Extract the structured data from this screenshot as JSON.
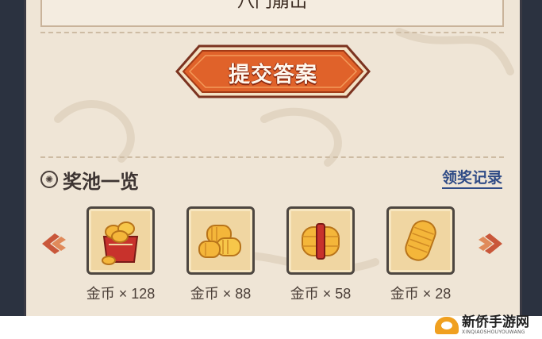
{
  "answer": {
    "text": "八门崩出"
  },
  "submit_button": {
    "label": "提交答案"
  },
  "prize_pool": {
    "title": "奖池一览",
    "records_link": "领奖记录",
    "items": [
      {
        "icon": "coin-box-icon",
        "label": "金币 × 128"
      },
      {
        "icon": "coin-stacks-icon",
        "label": "金币 × 88"
      },
      {
        "icon": "coin-bundle-icon",
        "label": "金币 × 58"
      },
      {
        "icon": "coin-roll-icon",
        "label": "金币 × 28"
      }
    ]
  },
  "navigation": {
    "prev_icon": "chevron-left-icon",
    "next_icon": "chevron-right-icon"
  },
  "watermark": {
    "name": "新侨手游网",
    "subtitle": "XINQIAOSHOUYOUWANG"
  },
  "colors": {
    "button": "#e0622a",
    "panel": "#efe5d6",
    "link": "#2f4b86",
    "tile": "#f0d6a2"
  }
}
